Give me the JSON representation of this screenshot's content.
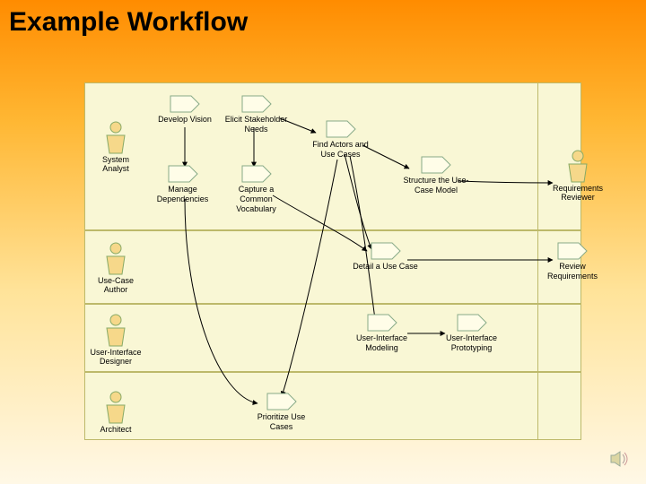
{
  "title": "Example Workflow",
  "roles": {
    "system_analyst": "System Analyst",
    "use_case_author": "Use-Case Author",
    "ui_designer": "User-Interface Designer",
    "architect": "Architect",
    "requirements_reviewer": "Requirements Reviewer"
  },
  "activities": {
    "develop_vision": "Develop Vision",
    "elicit_stakeholder_needs": "Elicit Stakeholder Needs",
    "find_actors_use_cases": "Find Actors and Use Cases",
    "manage_dependencies": "Manage Dependencies",
    "capture_common_vocabulary": "Capture a Common Vocabulary",
    "structure_use_case_model": "Structure the Use-Case Model",
    "detail_use_case": "Detail a Use Case",
    "review_requirements": "Review Requirements",
    "ui_modeling": "User-Interface Modeling",
    "ui_prototyping": "User-Interface Prototyping",
    "prioritize_use_cases": "Prioritize Use Cases"
  }
}
